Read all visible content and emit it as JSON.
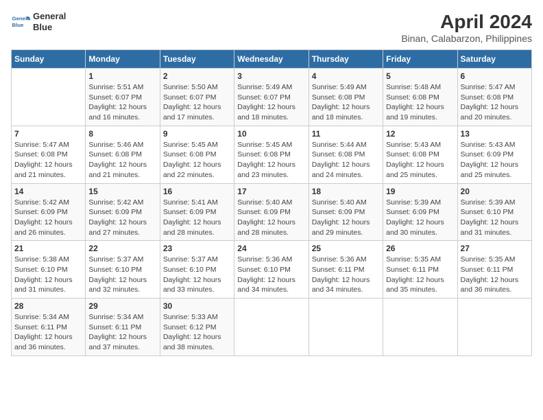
{
  "header": {
    "logo_line1": "General",
    "logo_line2": "Blue",
    "title": "April 2024",
    "subtitle": "Binan, Calabarzon, Philippines"
  },
  "calendar": {
    "days_of_week": [
      "Sunday",
      "Monday",
      "Tuesday",
      "Wednesday",
      "Thursday",
      "Friday",
      "Saturday"
    ],
    "weeks": [
      [
        {
          "num": "",
          "detail": ""
        },
        {
          "num": "1",
          "detail": "Sunrise: 5:51 AM\nSunset: 6:07 PM\nDaylight: 12 hours\nand 16 minutes."
        },
        {
          "num": "2",
          "detail": "Sunrise: 5:50 AM\nSunset: 6:07 PM\nDaylight: 12 hours\nand 17 minutes."
        },
        {
          "num": "3",
          "detail": "Sunrise: 5:49 AM\nSunset: 6:07 PM\nDaylight: 12 hours\nand 18 minutes."
        },
        {
          "num": "4",
          "detail": "Sunrise: 5:49 AM\nSunset: 6:08 PM\nDaylight: 12 hours\nand 18 minutes."
        },
        {
          "num": "5",
          "detail": "Sunrise: 5:48 AM\nSunset: 6:08 PM\nDaylight: 12 hours\nand 19 minutes."
        },
        {
          "num": "6",
          "detail": "Sunrise: 5:47 AM\nSunset: 6:08 PM\nDaylight: 12 hours\nand 20 minutes."
        }
      ],
      [
        {
          "num": "7",
          "detail": "Sunrise: 5:47 AM\nSunset: 6:08 PM\nDaylight: 12 hours\nand 21 minutes."
        },
        {
          "num": "8",
          "detail": "Sunrise: 5:46 AM\nSunset: 6:08 PM\nDaylight: 12 hours\nand 21 minutes."
        },
        {
          "num": "9",
          "detail": "Sunrise: 5:45 AM\nSunset: 6:08 PM\nDaylight: 12 hours\nand 22 minutes."
        },
        {
          "num": "10",
          "detail": "Sunrise: 5:45 AM\nSunset: 6:08 PM\nDaylight: 12 hours\nand 23 minutes."
        },
        {
          "num": "11",
          "detail": "Sunrise: 5:44 AM\nSunset: 6:08 PM\nDaylight: 12 hours\nand 24 minutes."
        },
        {
          "num": "12",
          "detail": "Sunrise: 5:43 AM\nSunset: 6:08 PM\nDaylight: 12 hours\nand 25 minutes."
        },
        {
          "num": "13",
          "detail": "Sunrise: 5:43 AM\nSunset: 6:09 PM\nDaylight: 12 hours\nand 25 minutes."
        }
      ],
      [
        {
          "num": "14",
          "detail": "Sunrise: 5:42 AM\nSunset: 6:09 PM\nDaylight: 12 hours\nand 26 minutes."
        },
        {
          "num": "15",
          "detail": "Sunrise: 5:42 AM\nSunset: 6:09 PM\nDaylight: 12 hours\nand 27 minutes."
        },
        {
          "num": "16",
          "detail": "Sunrise: 5:41 AM\nSunset: 6:09 PM\nDaylight: 12 hours\nand 28 minutes."
        },
        {
          "num": "17",
          "detail": "Sunrise: 5:40 AM\nSunset: 6:09 PM\nDaylight: 12 hours\nand 28 minutes."
        },
        {
          "num": "18",
          "detail": "Sunrise: 5:40 AM\nSunset: 6:09 PM\nDaylight: 12 hours\nand 29 minutes."
        },
        {
          "num": "19",
          "detail": "Sunrise: 5:39 AM\nSunset: 6:09 PM\nDaylight: 12 hours\nand 30 minutes."
        },
        {
          "num": "20",
          "detail": "Sunrise: 5:39 AM\nSunset: 6:10 PM\nDaylight: 12 hours\nand 31 minutes."
        }
      ],
      [
        {
          "num": "21",
          "detail": "Sunrise: 5:38 AM\nSunset: 6:10 PM\nDaylight: 12 hours\nand 31 minutes."
        },
        {
          "num": "22",
          "detail": "Sunrise: 5:37 AM\nSunset: 6:10 PM\nDaylight: 12 hours\nand 32 minutes."
        },
        {
          "num": "23",
          "detail": "Sunrise: 5:37 AM\nSunset: 6:10 PM\nDaylight: 12 hours\nand 33 minutes."
        },
        {
          "num": "24",
          "detail": "Sunrise: 5:36 AM\nSunset: 6:10 PM\nDaylight: 12 hours\nand 34 minutes."
        },
        {
          "num": "25",
          "detail": "Sunrise: 5:36 AM\nSunset: 6:11 PM\nDaylight: 12 hours\nand 34 minutes."
        },
        {
          "num": "26",
          "detail": "Sunrise: 5:35 AM\nSunset: 6:11 PM\nDaylight: 12 hours\nand 35 minutes."
        },
        {
          "num": "27",
          "detail": "Sunrise: 5:35 AM\nSunset: 6:11 PM\nDaylight: 12 hours\nand 36 minutes."
        }
      ],
      [
        {
          "num": "28",
          "detail": "Sunrise: 5:34 AM\nSunset: 6:11 PM\nDaylight: 12 hours\nand 36 minutes."
        },
        {
          "num": "29",
          "detail": "Sunrise: 5:34 AM\nSunset: 6:11 PM\nDaylight: 12 hours\nand 37 minutes."
        },
        {
          "num": "30",
          "detail": "Sunrise: 5:33 AM\nSunset: 6:12 PM\nDaylight: 12 hours\nand 38 minutes."
        },
        {
          "num": "",
          "detail": ""
        },
        {
          "num": "",
          "detail": ""
        },
        {
          "num": "",
          "detail": ""
        },
        {
          "num": "",
          "detail": ""
        }
      ]
    ]
  }
}
